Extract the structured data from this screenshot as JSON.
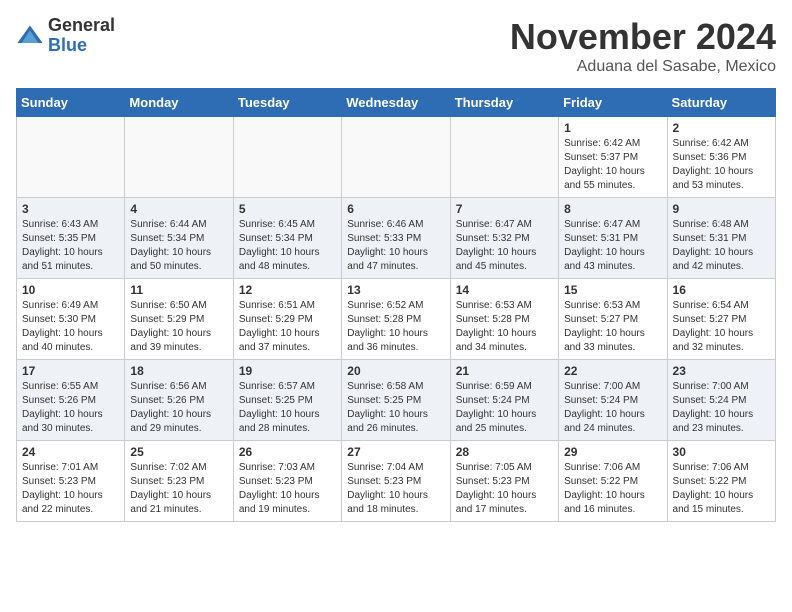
{
  "header": {
    "logo_general": "General",
    "logo_blue": "Blue",
    "month_year": "November 2024",
    "location": "Aduana del Sasabe, Mexico"
  },
  "days_of_week": [
    "Sunday",
    "Monday",
    "Tuesday",
    "Wednesday",
    "Thursday",
    "Friday",
    "Saturday"
  ],
  "weeks": [
    [
      {
        "day": "",
        "info": ""
      },
      {
        "day": "",
        "info": ""
      },
      {
        "day": "",
        "info": ""
      },
      {
        "day": "",
        "info": ""
      },
      {
        "day": "",
        "info": ""
      },
      {
        "day": "1",
        "info": "Sunrise: 6:42 AM\nSunset: 5:37 PM\nDaylight: 10 hours\nand 55 minutes."
      },
      {
        "day": "2",
        "info": "Sunrise: 6:42 AM\nSunset: 5:36 PM\nDaylight: 10 hours\nand 53 minutes."
      }
    ],
    [
      {
        "day": "3",
        "info": "Sunrise: 6:43 AM\nSunset: 5:35 PM\nDaylight: 10 hours\nand 51 minutes."
      },
      {
        "day": "4",
        "info": "Sunrise: 6:44 AM\nSunset: 5:34 PM\nDaylight: 10 hours\nand 50 minutes."
      },
      {
        "day": "5",
        "info": "Sunrise: 6:45 AM\nSunset: 5:34 PM\nDaylight: 10 hours\nand 48 minutes."
      },
      {
        "day": "6",
        "info": "Sunrise: 6:46 AM\nSunset: 5:33 PM\nDaylight: 10 hours\nand 47 minutes."
      },
      {
        "day": "7",
        "info": "Sunrise: 6:47 AM\nSunset: 5:32 PM\nDaylight: 10 hours\nand 45 minutes."
      },
      {
        "day": "8",
        "info": "Sunrise: 6:47 AM\nSunset: 5:31 PM\nDaylight: 10 hours\nand 43 minutes."
      },
      {
        "day": "9",
        "info": "Sunrise: 6:48 AM\nSunset: 5:31 PM\nDaylight: 10 hours\nand 42 minutes."
      }
    ],
    [
      {
        "day": "10",
        "info": "Sunrise: 6:49 AM\nSunset: 5:30 PM\nDaylight: 10 hours\nand 40 minutes."
      },
      {
        "day": "11",
        "info": "Sunrise: 6:50 AM\nSunset: 5:29 PM\nDaylight: 10 hours\nand 39 minutes."
      },
      {
        "day": "12",
        "info": "Sunrise: 6:51 AM\nSunset: 5:29 PM\nDaylight: 10 hours\nand 37 minutes."
      },
      {
        "day": "13",
        "info": "Sunrise: 6:52 AM\nSunset: 5:28 PM\nDaylight: 10 hours\nand 36 minutes."
      },
      {
        "day": "14",
        "info": "Sunrise: 6:53 AM\nSunset: 5:28 PM\nDaylight: 10 hours\nand 34 minutes."
      },
      {
        "day": "15",
        "info": "Sunrise: 6:53 AM\nSunset: 5:27 PM\nDaylight: 10 hours\nand 33 minutes."
      },
      {
        "day": "16",
        "info": "Sunrise: 6:54 AM\nSunset: 5:27 PM\nDaylight: 10 hours\nand 32 minutes."
      }
    ],
    [
      {
        "day": "17",
        "info": "Sunrise: 6:55 AM\nSunset: 5:26 PM\nDaylight: 10 hours\nand 30 minutes."
      },
      {
        "day": "18",
        "info": "Sunrise: 6:56 AM\nSunset: 5:26 PM\nDaylight: 10 hours\nand 29 minutes."
      },
      {
        "day": "19",
        "info": "Sunrise: 6:57 AM\nSunset: 5:25 PM\nDaylight: 10 hours\nand 28 minutes."
      },
      {
        "day": "20",
        "info": "Sunrise: 6:58 AM\nSunset: 5:25 PM\nDaylight: 10 hours\nand 26 minutes."
      },
      {
        "day": "21",
        "info": "Sunrise: 6:59 AM\nSunset: 5:24 PM\nDaylight: 10 hours\nand 25 minutes."
      },
      {
        "day": "22",
        "info": "Sunrise: 7:00 AM\nSunset: 5:24 PM\nDaylight: 10 hours\nand 24 minutes."
      },
      {
        "day": "23",
        "info": "Sunrise: 7:00 AM\nSunset: 5:24 PM\nDaylight: 10 hours\nand 23 minutes."
      }
    ],
    [
      {
        "day": "24",
        "info": "Sunrise: 7:01 AM\nSunset: 5:23 PM\nDaylight: 10 hours\nand 22 minutes."
      },
      {
        "day": "25",
        "info": "Sunrise: 7:02 AM\nSunset: 5:23 PM\nDaylight: 10 hours\nand 21 minutes."
      },
      {
        "day": "26",
        "info": "Sunrise: 7:03 AM\nSunset: 5:23 PM\nDaylight: 10 hours\nand 19 minutes."
      },
      {
        "day": "27",
        "info": "Sunrise: 7:04 AM\nSunset: 5:23 PM\nDaylight: 10 hours\nand 18 minutes."
      },
      {
        "day": "28",
        "info": "Sunrise: 7:05 AM\nSunset: 5:23 PM\nDaylight: 10 hours\nand 17 minutes."
      },
      {
        "day": "29",
        "info": "Sunrise: 7:06 AM\nSunset: 5:22 PM\nDaylight: 10 hours\nand 16 minutes."
      },
      {
        "day": "30",
        "info": "Sunrise: 7:06 AM\nSunset: 5:22 PM\nDaylight: 10 hours\nand 15 minutes."
      }
    ]
  ]
}
